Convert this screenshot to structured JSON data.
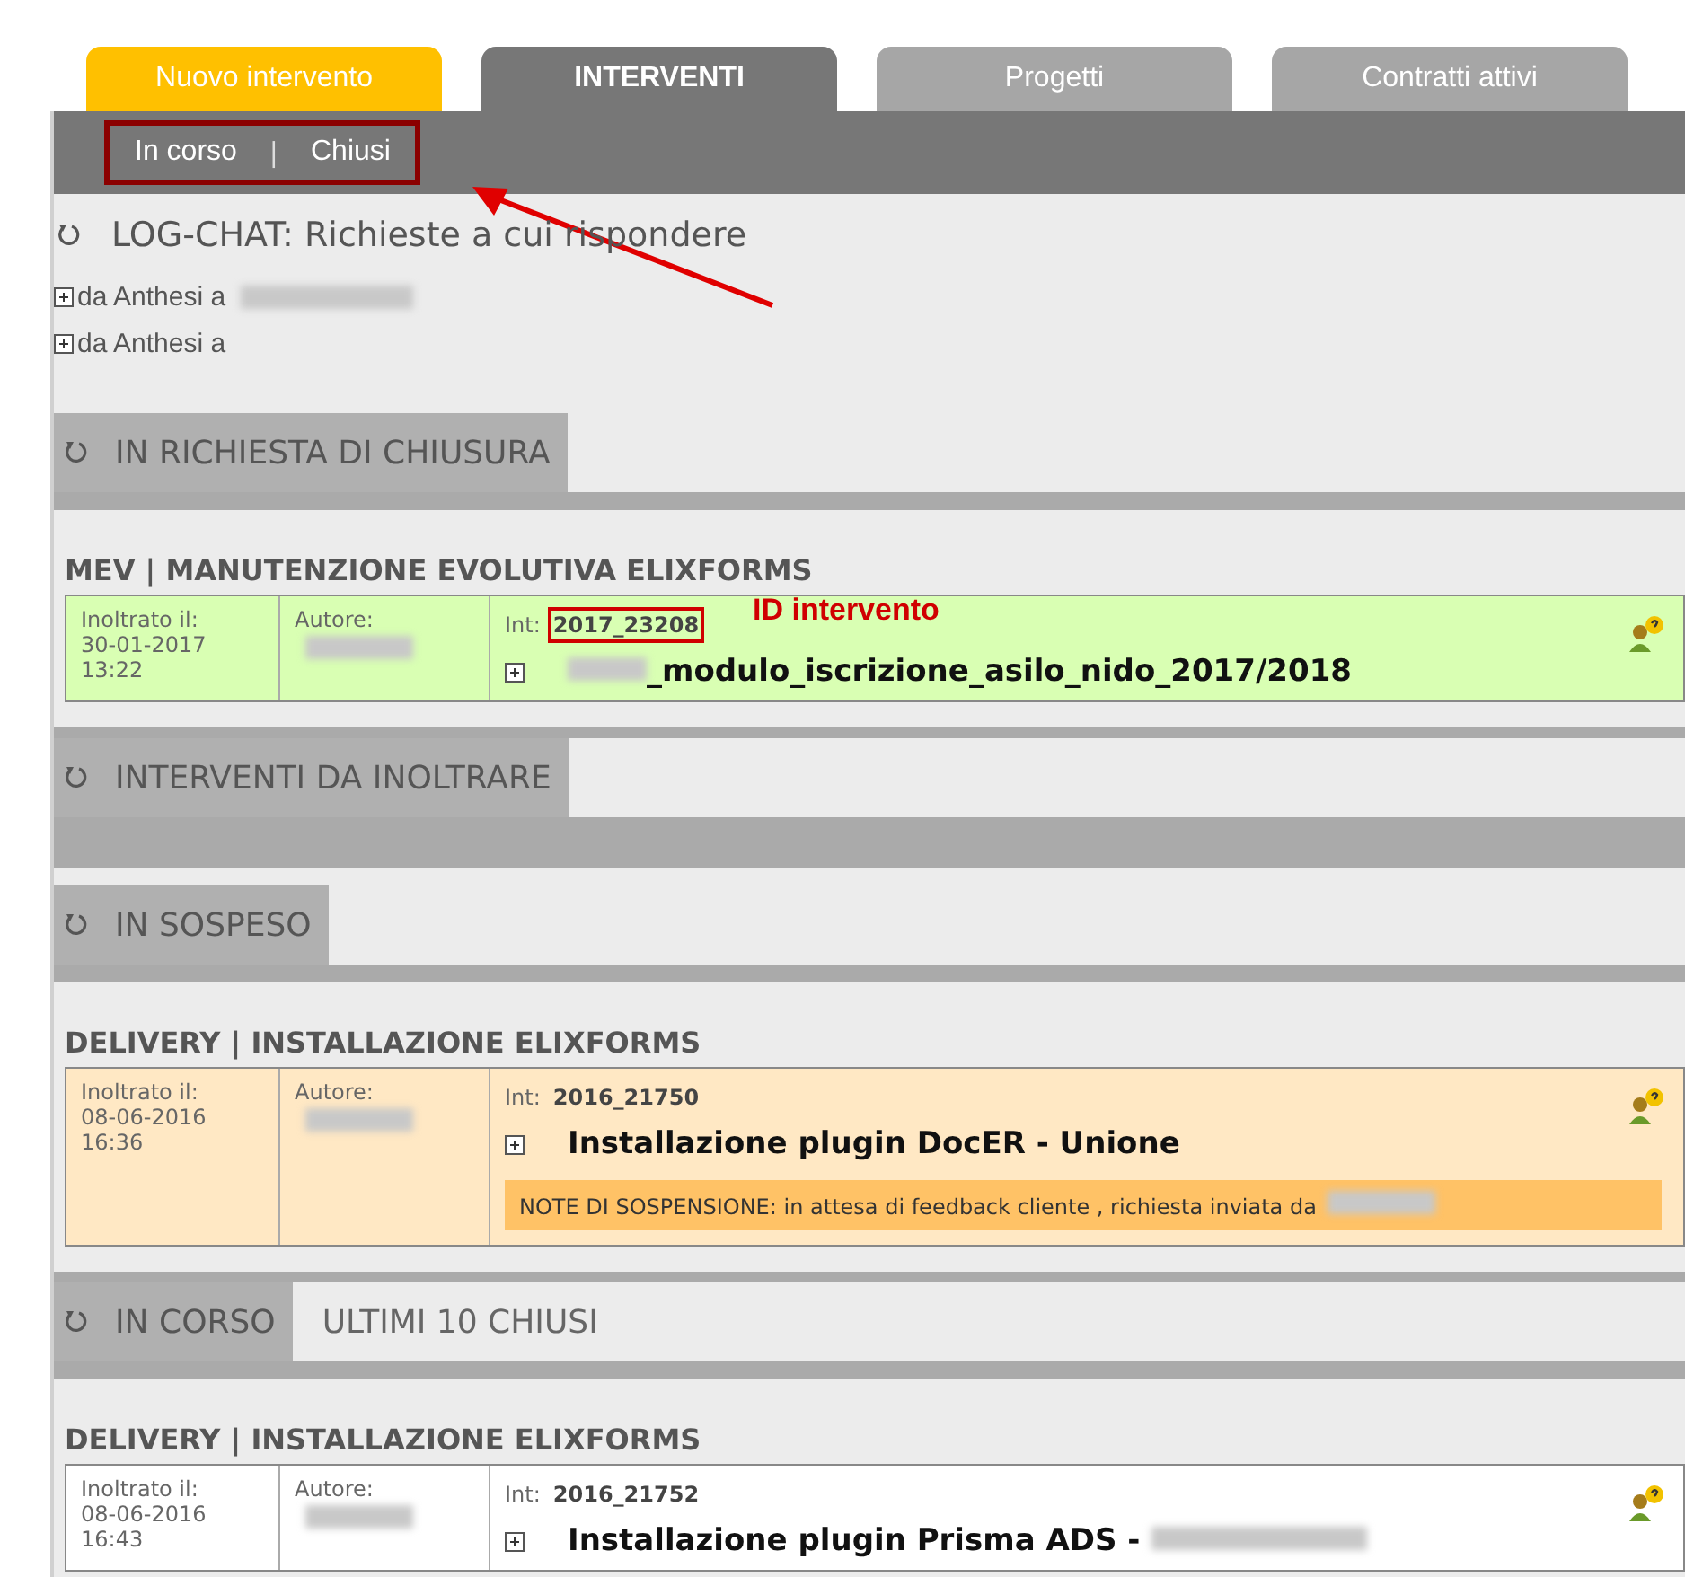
{
  "tabs": [
    {
      "label": "Nuovo intervento",
      "kind": "new",
      "selected": false
    },
    {
      "label": "INTERVENTI",
      "kind": "normal",
      "selected": true
    },
    {
      "label": "Progetti",
      "kind": "normal",
      "selected": false
    },
    {
      "label": "Contratti attivi",
      "kind": "normal",
      "selected": false
    }
  ],
  "subnav": {
    "items": [
      {
        "label": "In corso"
      },
      {
        "label": "Chiusi"
      }
    ],
    "separator": "|",
    "highlighted": true
  },
  "log_chat": {
    "title": "LOG-CHAT: Richieste a cui rispondere",
    "entries": [
      {
        "text": "da Anthesi a",
        "redacted": true
      },
      {
        "text": "da Anthesi a",
        "redacted": false
      }
    ]
  },
  "sections": [
    {
      "tabs": [
        {
          "label": "IN RICHIESTA DI CHIUSURA",
          "selected": true
        }
      ],
      "groups": [
        {
          "title": "MEV | MANUTENZIONE EVOLUTIVA ELIXFORMS",
          "items": [
            {
              "kind": "closing",
              "sent_label": "Inoltrato il:",
              "date": "30-01-2017",
              "time": "13:22",
              "author_label": "Autore:",
              "id_label": "Int:",
              "id": "2017_23208",
              "id_highlighted": true,
              "id_note": "ID intervento",
              "title": "_modulo_iscrizione_asilo_nido_2017/2018",
              "redacted_prefix": true
            }
          ]
        }
      ]
    },
    {
      "tabs": [
        {
          "label": "INTERVENTI DA INOLTRARE",
          "selected": true
        }
      ]
    },
    {
      "tabs": [
        {
          "label": "IN SOSPESO",
          "selected": true
        }
      ],
      "groups": [
        {
          "title": "DELIVERY | INSTALLAZIONE ELIXFORMS",
          "items": [
            {
              "kind": "suspended",
              "sent_label": "Inoltrato il:",
              "date": "08-06-2016",
              "time": "16:36",
              "author_label": "Autore:",
              "id_label": "Int:",
              "id": "2016_21750",
              "id_highlighted": false,
              "title": "Installazione plugin DocER - Unione",
              "note_label": "NOTE DI SOSPENSIONE:",
              "note": "in attesa di feedback cliente , richiesta inviata da"
            }
          ]
        }
      ]
    },
    {
      "tabs": [
        {
          "label": "IN CORSO",
          "selected": true
        },
        {
          "label": "ULTIMI 10 CHIUSI",
          "selected": false
        }
      ],
      "groups": [
        {
          "title": "DELIVERY | INSTALLAZIONE ELIXFORMS",
          "items": [
            {
              "kind": "open",
              "sent_label": "Inoltrato il:",
              "date": "08-06-2016",
              "time": "16:43",
              "author_label": "Autore:",
              "id_label": "Int:",
              "id": "2016_21752",
              "id_highlighted": false,
              "title": "Installazione plugin Prisma ADS -",
              "redacted_suffix": true
            }
          ]
        }
      ]
    }
  ]
}
